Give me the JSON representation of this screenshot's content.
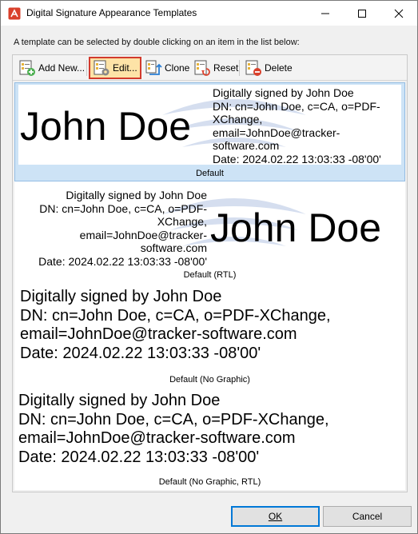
{
  "window": {
    "title": "Digital Signature Appearance Templates"
  },
  "instruction": "A template can be selected by double clicking on an item in the list below:",
  "toolbar": {
    "add_label": "Add New...",
    "edit_label": "Edit...",
    "clone_label": "Clone",
    "reset_label": "Reset",
    "delete_label": "Delete"
  },
  "signature": {
    "name": "John Doe",
    "line1": "Digitally signed by John Doe",
    "line2": "DN: cn=John Doe, c=CA, o=PDF-XChange,",
    "line3": "email=JohnDoe@tracker-software.com",
    "line4": "Date: 2024.02.22 13:03:33 -08'00'",
    "wrap_a": "DN: cn=John Doe, c=CA, o=PDF-",
    "wrap_b": "XChange,",
    "wrap_c": "email=JohnDoe@tracker-",
    "wrap_d": "software.com",
    "rtl_b": "DN: cn=John Doe, c=CA, o=PDF-",
    "rtl_c": "XChange,",
    "rtl_d": "email=JohnDoe@tracker-",
    "rtl_e": "software.com"
  },
  "templates": [
    {
      "caption": "Default",
      "selected": true
    },
    {
      "caption": "Default (RTL)",
      "selected": false
    },
    {
      "caption": "Default (No Graphic)",
      "selected": false
    },
    {
      "caption": "Default (No Graphic, RTL)",
      "selected": false
    }
  ],
  "buttons": {
    "ok_label": "OK",
    "cancel_label": "Cancel"
  },
  "colors": {
    "selection": "#cde3f6",
    "highlight": "#d23a2c",
    "accent": "#0078d7"
  }
}
